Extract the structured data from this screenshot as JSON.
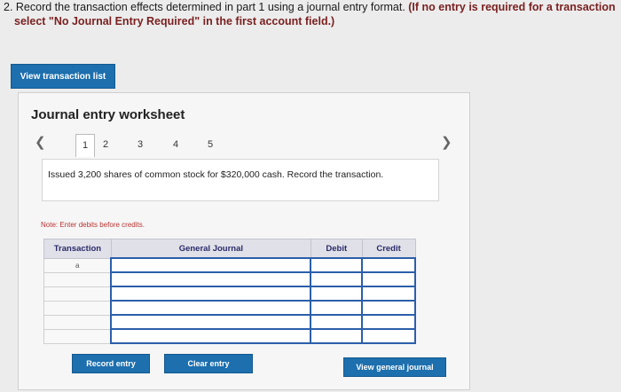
{
  "question": {
    "line1_plain": "2. Record the transaction effects determined in part 1 using a journal entry format. ",
    "line1_bold": "(If no entry is required for a transaction",
    "line2_bold": "select \"No Journal Entry Required\" in the first account field.)"
  },
  "view_transaction_list_label": "View transaction list",
  "worksheet": {
    "title": "Journal entry worksheet",
    "pages": [
      "1",
      "2",
      "3",
      "4",
      "5"
    ],
    "active_page": "1",
    "prev_icon": "chevron-left-icon",
    "next_icon": "chevron-right-icon",
    "description": "Issued 3,200 shares of common stock for $320,000 cash. Record the transaction.",
    "note": "Note: Enter debits before credits."
  },
  "table": {
    "headers": [
      "Transaction",
      "General Journal",
      "Debit",
      "Credit"
    ],
    "rows": [
      {
        "transaction": "a",
        "account": "",
        "debit": "",
        "credit": ""
      },
      {
        "transaction": "",
        "account": "",
        "debit": "",
        "credit": ""
      },
      {
        "transaction": "",
        "account": "",
        "debit": "",
        "credit": ""
      },
      {
        "transaction": "",
        "account": "",
        "debit": "",
        "credit": ""
      },
      {
        "transaction": "",
        "account": "",
        "debit": "",
        "credit": ""
      },
      {
        "transaction": "",
        "account": "",
        "debit": "",
        "credit": ""
      }
    ]
  },
  "buttons": {
    "record": "Record entry",
    "clear": "Clear entry",
    "view_journal": "View general journal"
  },
  "colors": {
    "accent": "#1d6fae",
    "question_emphasis": "#7a1f1f",
    "input_border": "#2b5faa"
  }
}
